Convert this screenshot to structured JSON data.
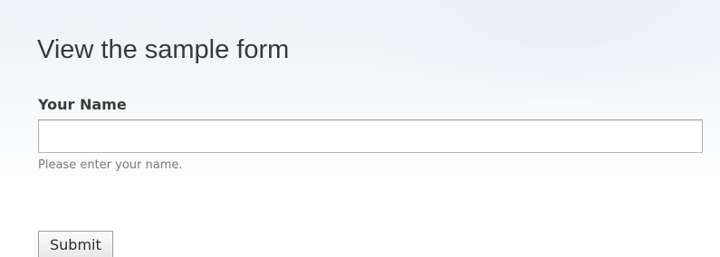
{
  "form": {
    "title": "View the sample form",
    "name_field": {
      "label": "Your Name",
      "value": "",
      "help_text": "Please enter your name."
    },
    "submit_label": "Submit"
  }
}
